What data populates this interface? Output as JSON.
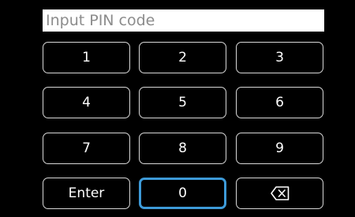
{
  "pin_input": {
    "value": "",
    "placeholder": "Input PIN code"
  },
  "keypad": {
    "digits": [
      "1",
      "2",
      "3",
      "4",
      "5",
      "6",
      "7",
      "8",
      "9"
    ],
    "enter_label": "Enter",
    "zero_label": "0",
    "backspace_icon": "backspace-icon",
    "focused_key": "0"
  },
  "colors": {
    "background": "#000000",
    "key_border": "#d7d7d7",
    "focus_border": "#3d9ad8",
    "field_background": "#ffffff",
    "placeholder_text": "#8c8c8c"
  }
}
